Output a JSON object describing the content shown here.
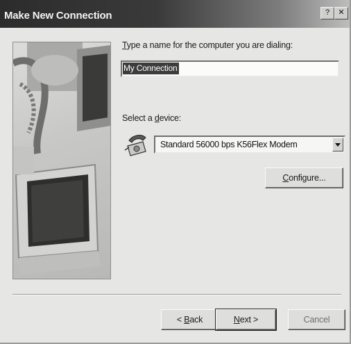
{
  "window": {
    "title": "Make New Connection"
  },
  "title_controls": {
    "help": "?",
    "close": "✕"
  },
  "form": {
    "name_label_first": "T",
    "name_label_rest": "ype a name for the computer you are dialing:",
    "name_value": "My Connection",
    "device_label_prefix": "Select a ",
    "device_label_underlined": "d",
    "device_label_rest": "evice:",
    "device_selected": "Standard 56000 bps K56Flex Modem",
    "configure_prefix": "",
    "configure_underlined": "C",
    "configure_rest": "onfigure..."
  },
  "buttons": {
    "back_prefix": "< ",
    "back_underlined": "B",
    "back_rest": "ack",
    "next_underlined": "N",
    "next_rest": "ext >",
    "cancel": "Cancel"
  },
  "icons": {
    "phone": "telephone-modem-icon",
    "dropdown": "chevron-down-icon",
    "illustration": "computer-and-phone-illustration"
  },
  "colors": {
    "title_bar": "#2c2c2c",
    "dialog_bg": "#e6e6e4",
    "selection": "#3c3c3c"
  }
}
